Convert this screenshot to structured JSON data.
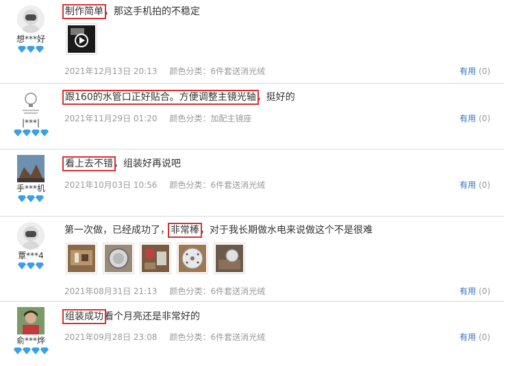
{
  "reviews": [
    {
      "user": "想***好",
      "diamonds": 3,
      "text_hl": "制作简单",
      "text_rest": "，那这手机拍的不稳定",
      "date": "2021年12月13日 20:13",
      "color_label": "颜色分类：",
      "color_value": "6件套送消光绒",
      "useful_label": "有用",
      "useful_count": "(0)"
    },
    {
      "user": "|***|",
      "diamonds": 4,
      "text_hl": "跟160的水管口正好贴合。方便调整主镜光轴",
      "text_rest": "，挺好的",
      "date": "2021年11月29日 01:20",
      "color_label": "颜色分类：",
      "color_value": "加配主镜座",
      "useful_label": "有用",
      "useful_count": "(0)"
    },
    {
      "user": "手***机",
      "diamonds": 3,
      "text_hl": "看上去不错",
      "text_rest": "，组装好再说吧",
      "date": "2021年10月03日 10:56",
      "color_label": "颜色分类：",
      "color_value": "6件套送消光绒",
      "useful_label": "有用",
      "useful_count": "(0)"
    },
    {
      "user": "覃***4",
      "diamonds": 3,
      "text_pre": "第一次做，已经成功了，",
      "text_hl": "非常棒",
      "text_rest": "，对于我长期做水电来说做这个不是很难",
      "date": "2021年08月31日 21:13",
      "color_label": "颜色分类：",
      "color_value": "6件套送消光绒",
      "useful_label": "有用",
      "useful_count": "(0)"
    },
    {
      "user": "俞***烨",
      "diamonds": 4,
      "text_hl": "组装成功",
      "text_rest": "看个月亮还是非常好的",
      "date": "2021年09月28日 23:08",
      "color_label": "颜色分类：",
      "color_value": "6件套送消光绒",
      "useful_label": "有用",
      "useful_count": "(0)"
    }
  ],
  "colors": {
    "highlight": "#d93030",
    "useful": "#2f6fbf",
    "meta": "#999999",
    "diamond": "#3aa0e6"
  }
}
